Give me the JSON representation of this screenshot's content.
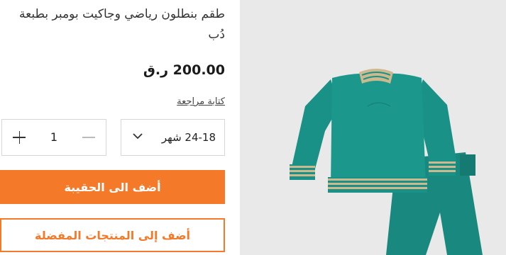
{
  "product": {
    "title": "طقم بنطلون رياضي وجاكيت بومبر بطبعة دُب",
    "price": "200.00 ر.ق",
    "review_link": "كتابة مراجعة",
    "quantity": "1",
    "size_selected": "24-18 شهر",
    "add_to_bag": "أضف الى الحقيبة",
    "add_to_wishlist": "أضف إلى المنتجات المفضلة"
  },
  "colors": {
    "accent": "#f47a2a",
    "garment_teal": "#1a9186",
    "stripe_beige": "#cdb98d",
    "image_bg": "#e9e9ea"
  },
  "icons": {
    "plus": "plus-icon",
    "minus": "minus-icon",
    "dropdown": "chevron-down-icon"
  }
}
